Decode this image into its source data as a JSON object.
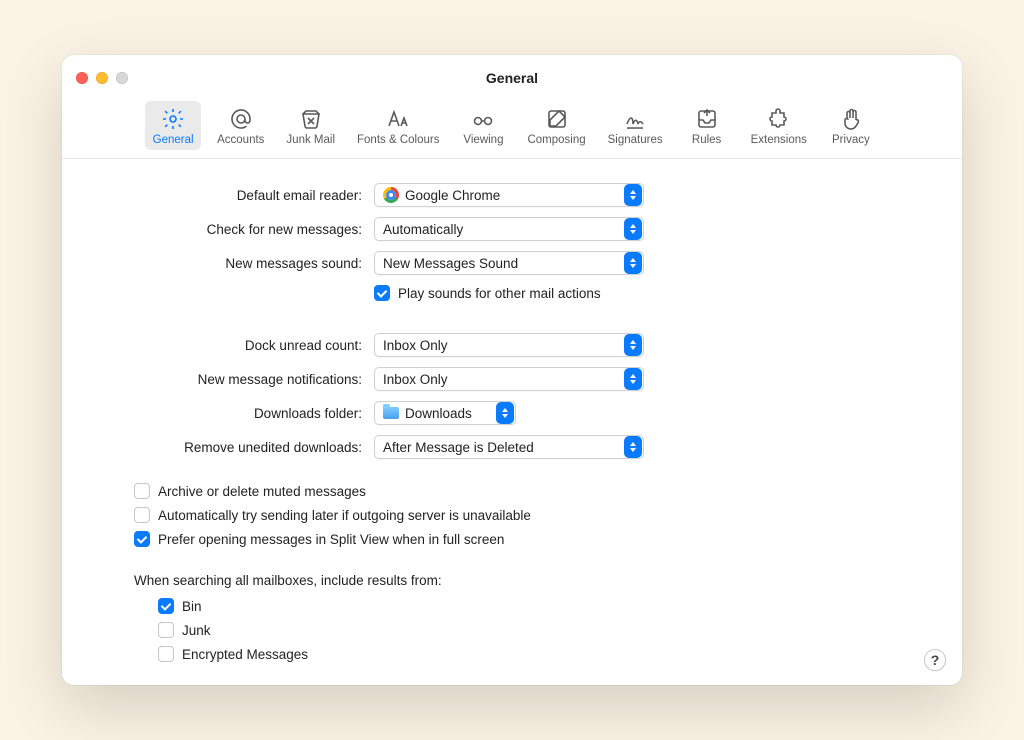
{
  "window": {
    "title": "General"
  },
  "toolbar": {
    "items": [
      {
        "label": "General",
        "active": true
      },
      {
        "label": "Accounts",
        "active": false
      },
      {
        "label": "Junk Mail",
        "active": false
      },
      {
        "label": "Fonts & Colours",
        "active": false
      },
      {
        "label": "Viewing",
        "active": false
      },
      {
        "label": "Composing",
        "active": false
      },
      {
        "label": "Signatures",
        "active": false
      },
      {
        "label": "Rules",
        "active": false
      },
      {
        "label": "Extensions",
        "active": false
      },
      {
        "label": "Privacy",
        "active": false
      }
    ]
  },
  "form": {
    "default_reader": {
      "label": "Default email reader:",
      "value": "Google Chrome"
    },
    "check_messages": {
      "label": "Check for new messages:",
      "value": "Automatically"
    },
    "new_sound": {
      "label": "New messages sound:",
      "value": "New Messages Sound"
    },
    "play_sounds": {
      "label": "Play sounds for other mail actions",
      "checked": true
    },
    "dock_unread": {
      "label": "Dock unread count:",
      "value": "Inbox Only"
    },
    "notifications": {
      "label": "New message notifications:",
      "value": "Inbox Only"
    },
    "downloads_folder": {
      "label": "Downloads folder:",
      "value": "Downloads"
    },
    "remove_downloads": {
      "label": "Remove unedited downloads:",
      "value": "After Message is Deleted"
    }
  },
  "options": {
    "archive_muted": {
      "label": "Archive or delete muted messages",
      "checked": false
    },
    "retry_send": {
      "label": "Automatically try sending later if outgoing server is unavailable",
      "checked": false
    },
    "split_view": {
      "label": "Prefer opening messages in Split View when in full screen",
      "checked": true
    }
  },
  "search_section": {
    "heading": "When searching all mailboxes, include results from:",
    "bin": {
      "label": "Bin",
      "checked": true
    },
    "junk": {
      "label": "Junk",
      "checked": false
    },
    "encrypted": {
      "label": "Encrypted Messages",
      "checked": false
    }
  },
  "help": {
    "label": "?"
  }
}
